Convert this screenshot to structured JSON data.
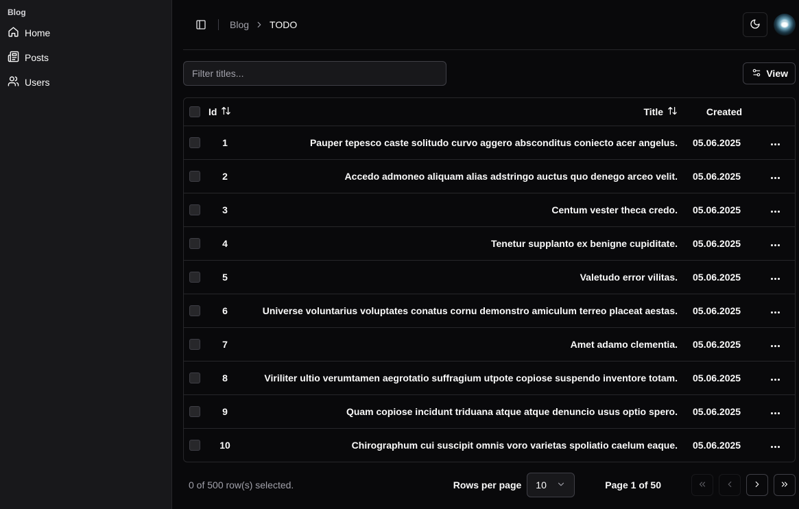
{
  "sidebar": {
    "group_label": "Blog",
    "items": [
      {
        "label": "Home",
        "icon": "home-icon"
      },
      {
        "label": "Posts",
        "icon": "newspaper-icon"
      },
      {
        "label": "Users",
        "icon": "users-icon"
      }
    ]
  },
  "header": {
    "breadcrumb": {
      "parent": "Blog",
      "current": "TODO"
    }
  },
  "toolbar": {
    "filter_placeholder": "Filter titles...",
    "view_label": "View"
  },
  "table": {
    "columns": {
      "id": "Id",
      "title": "Title",
      "created": "Created"
    },
    "rows": [
      {
        "id": "1",
        "title": "Pauper tepesco caste solitudo curvo aggero absconditus coniecto acer angelus.",
        "created": "05.06.2025"
      },
      {
        "id": "2",
        "title": "Accedo admoneo aliquam alias adstringo auctus quo denego arceo velit.",
        "created": "05.06.2025"
      },
      {
        "id": "3",
        "title": "Centum vester theca credo.",
        "created": "05.06.2025"
      },
      {
        "id": "4",
        "title": "Tenetur supplanto ex benigne cupiditate.",
        "created": "05.06.2025"
      },
      {
        "id": "5",
        "title": "Valetudo error vilitas.",
        "created": "05.06.2025"
      },
      {
        "id": "6",
        "title": "Universe voluntarius voluptates conatus cornu demonstro amiculum terreo placeat aestas.",
        "created": "05.06.2025"
      },
      {
        "id": "7",
        "title": "Amet adamo clementia.",
        "created": "05.06.2025"
      },
      {
        "id": "8",
        "title": "Viriliter ultio verumtamen aegrotatio suffragium utpote copiose suspendo inventore totam.",
        "created": "05.06.2025"
      },
      {
        "id": "9",
        "title": "Quam copiose incidunt triduana atque atque denuncio usus optio spero.",
        "created": "05.06.2025"
      },
      {
        "id": "10",
        "title": "Chirographum cui suscipit omnis voro varietas spoliatio caelum eaque.",
        "created": "05.06.2025"
      }
    ]
  },
  "footer": {
    "selected_text": "0 of 500 row(s) selected.",
    "rows_per_page_label": "Rows per page",
    "rows_per_page_value": "10",
    "page_info": "Page 1 of 50"
  }
}
